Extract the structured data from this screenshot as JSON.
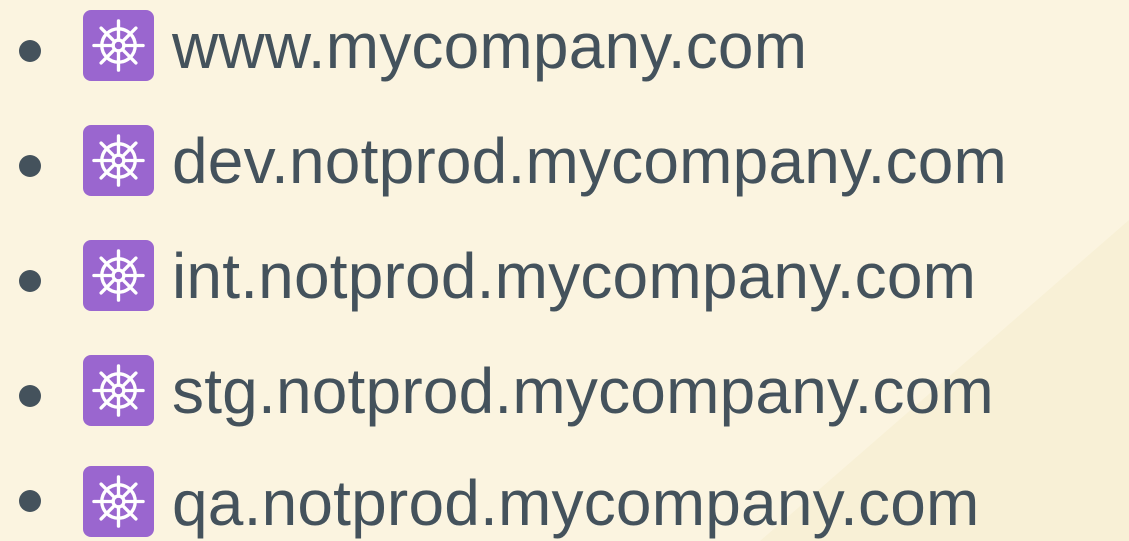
{
  "domains": {
    "icon": "ship-wheel-icon",
    "icon_color": "#9a66cf",
    "text_color": "#44525c",
    "background": "#fbf4e0",
    "items": [
      {
        "label": "www.mycompany.com"
      },
      {
        "label": "dev.notprod.mycompany.com"
      },
      {
        "label": "int.notprod.mycompany.com"
      },
      {
        "label": "stg.notprod.mycompany.com"
      },
      {
        "label": "qa.notprod.mycompany.com"
      }
    ]
  }
}
